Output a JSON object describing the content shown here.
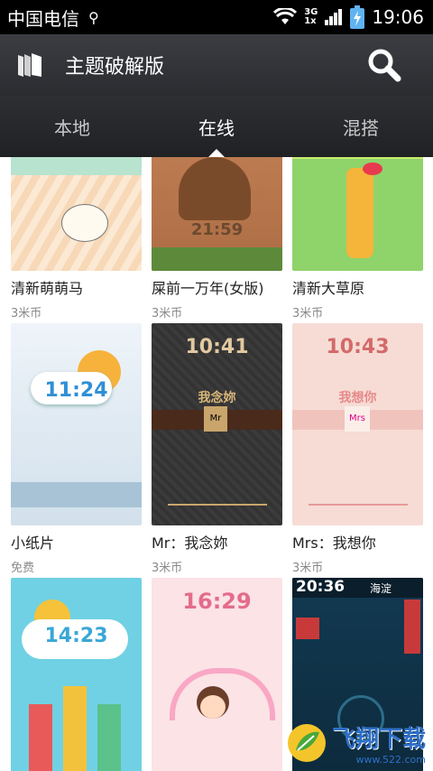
{
  "statusbar": {
    "carrier": "中国电信",
    "net_top": "3G",
    "net_bottom": "1x",
    "time": "19:06"
  },
  "header": {
    "title": "主题破解版"
  },
  "tabs": [
    {
      "label": "本地"
    },
    {
      "label": "在线"
    },
    {
      "label": "混搭"
    }
  ],
  "themes": [
    {
      "name": "清新萌萌马",
      "price": "3米币"
    },
    {
      "name": "屎前一万年(女版)",
      "price": "3米币",
      "clock": "21:59"
    },
    {
      "name": "清新大草原",
      "price": "3米币"
    },
    {
      "name": "小纸片",
      "price": "免费",
      "clock": "11:24"
    },
    {
      "name": "Mr：我念妳",
      "price": "3米币",
      "clock": "10:41",
      "caption": "我念妳",
      "tag": "Mr"
    },
    {
      "name": "Mrs：我想你",
      "price": "3米币",
      "clock": "10:43",
      "caption": "我想你",
      "tag": "Mrs"
    },
    {
      "name": "",
      "price": "",
      "clock": "14:23"
    },
    {
      "name": "",
      "price": "",
      "clock": "16:29"
    },
    {
      "name": "",
      "price": "",
      "clock": "20:36",
      "extra": "海淀"
    }
  ],
  "watermark": {
    "text": "飞翔下载",
    "url": "www.522.com"
  },
  "colors": {
    "actionbar": "#34363a",
    "accent": "#2e6fc7"
  }
}
